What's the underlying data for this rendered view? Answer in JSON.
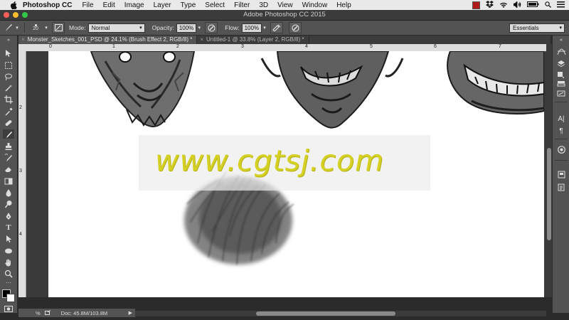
{
  "menubar": {
    "app_name": "Photoshop CC",
    "items": [
      "File",
      "Edit",
      "Image",
      "Layer",
      "Type",
      "Select",
      "Filter",
      "3D",
      "View",
      "Window",
      "Help"
    ]
  },
  "window": {
    "title": "Adobe Photoshop CC 2015"
  },
  "options": {
    "brush_size": "20",
    "mode_label": "Mode:",
    "mode_value": "Normal",
    "opacity_label": "Opacity:",
    "opacity_value": "100%",
    "flow_label": "Flow:",
    "flow_value": "100%",
    "workspace": "Essentials"
  },
  "tabs": [
    {
      "label": "Monster_Sketches_001_PSD @ 24.1% (Brush Effect 2, RGB/8) *"
    },
    {
      "label": "Untitled-1 @ 33.8% (Layer 2, RGB/8) *"
    }
  ],
  "rulers": {
    "top": [
      "0",
      "1",
      "2",
      "3",
      "4",
      "5",
      "6",
      "7"
    ],
    "left": [
      "2",
      "3",
      "4"
    ]
  },
  "watermark": "www.cgtsj.com",
  "status": {
    "zoom": "%",
    "doc": "Doc: 45.8M/103.8M"
  },
  "colors": {
    "foreground": "#000000",
    "background": "#ffffff",
    "watermark": "#d4d024"
  }
}
